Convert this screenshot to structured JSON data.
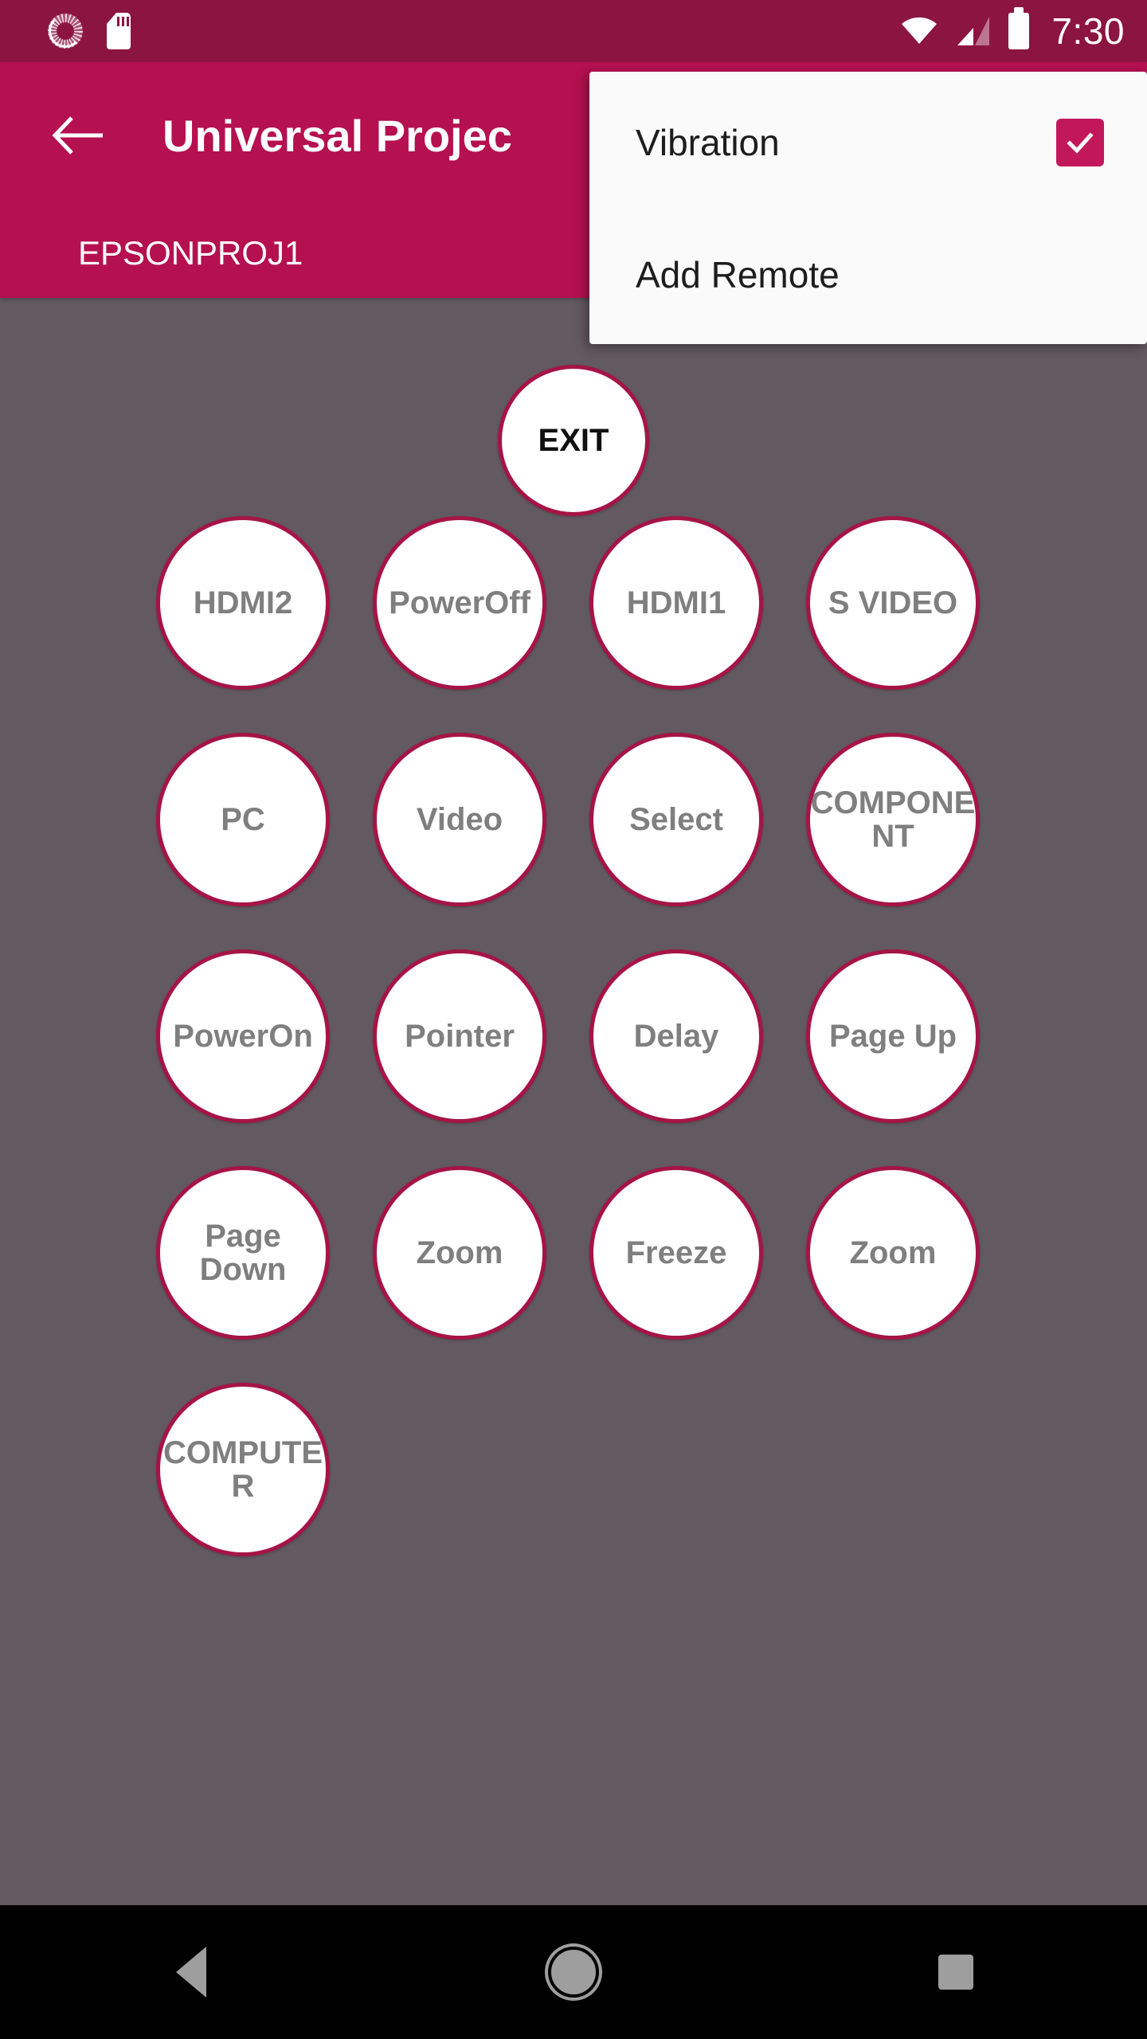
{
  "status_bar": {
    "time": "7:30",
    "icons": {
      "sync": "sync-icon",
      "sd_card": "sd-card-icon",
      "wifi": "wifi-icon",
      "signal": "cellular-signal-icon",
      "battery": "battery-icon"
    },
    "background": "#8C1440"
  },
  "app_bar": {
    "back": "back-arrow-icon",
    "title": "Universal Projec",
    "title_full": "Universal Projector",
    "background": "#B5104F"
  },
  "subtitle_bar": {
    "device_name": "EPSONPROJ1"
  },
  "overflow_menu": {
    "visible": true,
    "items": [
      {
        "label": "Vibration",
        "has_checkbox": true,
        "checked": true
      },
      {
        "label": "Add Remote",
        "has_checkbox": false,
        "checked": false
      }
    ],
    "checkbox_color": "#C2185B",
    "background": "#FAFAFA"
  },
  "remote": {
    "background": "#635A61",
    "button_border_color": "#A61446",
    "button_fill": "#FFFFFF",
    "button_text_color": "#7F7F7F",
    "exit_button": {
      "label": "EXIT"
    },
    "buttons": [
      {
        "label": "HDMI2"
      },
      {
        "label": "PowerOff"
      },
      {
        "label": "HDMI1"
      },
      {
        "label": "S VIDEO"
      },
      {
        "label": "PC"
      },
      {
        "label": "Video"
      },
      {
        "label": "Select"
      },
      {
        "label": "COMPONENT"
      },
      {
        "label": "PowerOn"
      },
      {
        "label": "Pointer"
      },
      {
        "label": "Delay"
      },
      {
        "label": "Page Up"
      },
      {
        "label": "Page Down"
      },
      {
        "label": "Zoom"
      },
      {
        "label": "Freeze"
      },
      {
        "label": "Zoom"
      },
      {
        "label": "COMPUTER"
      }
    ]
  },
  "nav_bar": {
    "back": "nav-back-icon",
    "home": "nav-home-icon",
    "recents": "nav-recents-icon"
  }
}
